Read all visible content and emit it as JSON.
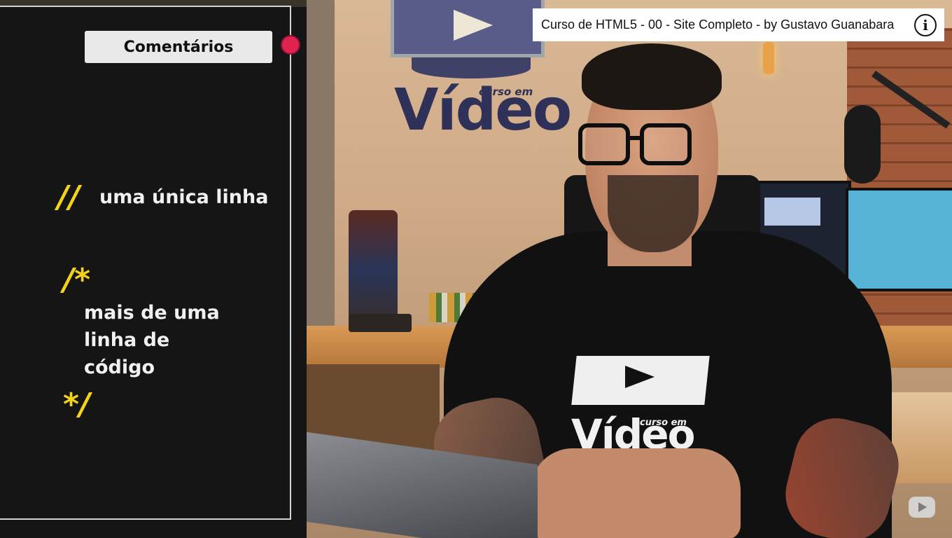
{
  "panel": {
    "title": "Comentários",
    "single_line_symbol": "//",
    "single_line_text": "uma única linha",
    "multi_open_symbol": "/*",
    "multi_lines": [
      "mais de uma",
      "linha de",
      "código"
    ],
    "multi_close_symbol": "*/",
    "accent_color": "#f2d21a",
    "rec_dot_color": "#e0244f"
  },
  "backdrop": {
    "logo_text": "Vídeo",
    "logo_small": "curso em"
  },
  "presenter": {
    "shirt_logo_text": "Vídeo",
    "shirt_logo_small": "curso em"
  },
  "video": {
    "title": "Curso de HTML5 - 00 - Site Completo - by Gustavo Guanabara",
    "info_icon": "info-icon",
    "watermark_icon": "youtube-logo-icon"
  }
}
